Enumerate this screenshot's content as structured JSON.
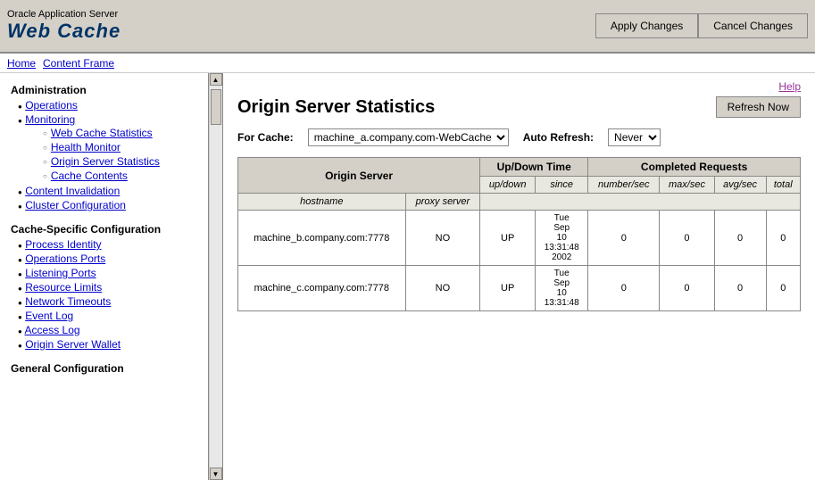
{
  "header": {
    "title_top": "Oracle Application Server",
    "title_main": "Web Cache",
    "apply_btn": "Apply Changes",
    "cancel_btn": "Cancel Changes"
  },
  "nav": {
    "home": "Home",
    "content_frame": "Content Frame"
  },
  "sidebar": {
    "admin_title": "Administration",
    "admin_items": [
      {
        "label": "Operations",
        "sub": []
      },
      {
        "label": "Monitoring",
        "sub": [
          "Web Cache Statistics",
          "Health Monitor",
          "Origin Server Statistics",
          "Cache Contents"
        ]
      },
      {
        "label": "Content Invalidation",
        "sub": []
      },
      {
        "label": "Cluster Configuration",
        "sub": []
      }
    ],
    "cache_config_title": "Cache-Specific Configuration",
    "cache_config_items": [
      "Process Identity",
      "Operations Ports",
      "Listening Ports",
      "Resource Limits",
      "Network Timeouts",
      "Event Log",
      "Access Log",
      "Origin Server Wallet"
    ],
    "general_config_title": "General Configuration"
  },
  "content": {
    "help_label": "Help",
    "page_title": "Origin Server Statistics",
    "refresh_btn": "Refresh Now",
    "for_cache_label": "For Cache:",
    "cache_value": "machine_a.company.com-WebCache",
    "auto_refresh_label": "Auto Refresh:",
    "auto_refresh_value": "Never",
    "table": {
      "col_origin_server": "Origin Server",
      "col_updown_time": "Up/Down Time",
      "col_completed_requests": "Completed Requests",
      "sub_hostname": "hostname",
      "sub_proxy_server": "proxy server",
      "sub_updown": "up/down",
      "sub_since": "since",
      "sub_number_sec": "number/sec",
      "sub_max_sec": "max/sec",
      "sub_avg_sec": "avg/sec",
      "sub_total": "total",
      "rows": [
        {
          "hostname": "machine_b.company.com:7778",
          "proxy_server": "NO",
          "updown": "UP",
          "since": "Tue Sep 10 13:31:48 2002",
          "number_sec": "0",
          "max_sec": "0",
          "avg_sec": "0",
          "total": "0"
        },
        {
          "hostname": "machine_c.company.com:7778",
          "proxy_server": "NO",
          "updown": "UP",
          "since": "Tue Sep 10 13:31:48",
          "number_sec": "0",
          "max_sec": "0",
          "avg_sec": "0",
          "total": "0"
        }
      ]
    }
  }
}
